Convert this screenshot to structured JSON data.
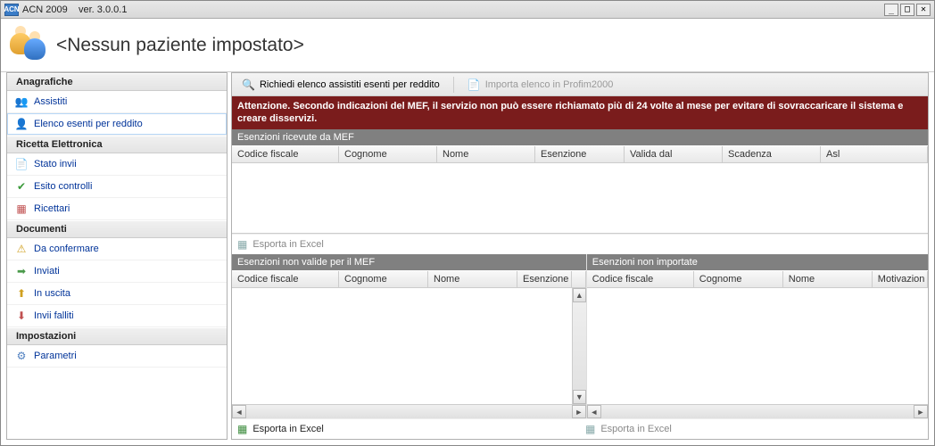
{
  "window": {
    "app_label": "ACN 2009",
    "version_prefix": "ver.",
    "version": "3.0.0.1",
    "app_icon_text": "ACN"
  },
  "header": {
    "title": "<Nessun paziente impostato>"
  },
  "sidebar": {
    "sections": [
      {
        "title": "Anagrafiche",
        "items": [
          {
            "label": "Assistiti",
            "icon": "people-icon",
            "glyph": "👥"
          },
          {
            "label": "Elenco esenti per reddito",
            "icon": "exemption-icon",
            "glyph": "👤",
            "selected": true
          }
        ]
      },
      {
        "title": "Ricetta Elettronica",
        "items": [
          {
            "label": "Stato invii",
            "icon": "status-icon",
            "glyph": "📄"
          },
          {
            "label": "Esito controlli",
            "icon": "check-icon",
            "glyph": "✔"
          },
          {
            "label": "Ricettari",
            "icon": "calendar-icon",
            "glyph": "▦"
          }
        ]
      },
      {
        "title": "Documenti",
        "items": [
          {
            "label": "Da confermare",
            "icon": "warn-icon",
            "glyph": "⚠"
          },
          {
            "label": "Inviati",
            "icon": "sent-icon",
            "glyph": "➡"
          },
          {
            "label": "In uscita",
            "icon": "outbox-icon",
            "glyph": "⬆"
          },
          {
            "label": "Invii falliti",
            "icon": "failed-icon",
            "glyph": "⬇"
          }
        ]
      },
      {
        "title": "Impostazioni",
        "items": [
          {
            "label": "Parametri",
            "icon": "gear-icon",
            "glyph": "⚙"
          }
        ]
      }
    ]
  },
  "toolbar": {
    "request_label": "Richiedi elenco assistiti esenti per reddito",
    "import_label": "Importa elenco in Profim2000"
  },
  "warning": "Attenzione. Secondo indicazioni del MEF, il servizio non può essere richiamato più di 24 volte al mese per evitare di sovraccaricare il sistema e creare disservizi.",
  "panels": {
    "received": {
      "title": "Esenzioni ricevute da MEF",
      "columns": [
        "Codice fiscale",
        "Cognome",
        "Nome",
        "Esenzione",
        "Valida dal",
        "Scadenza",
        "Asl"
      ],
      "export_label": "Esporta in Excel"
    },
    "invalid": {
      "title": "Esenzioni non valide per il MEF",
      "columns": [
        "Codice fiscale",
        "Cognome",
        "Nome",
        "Esenzione"
      ],
      "export_label": "Esporta in Excel"
    },
    "not_imported": {
      "title": "Esenzioni non importate",
      "columns": [
        "Codice fiscale",
        "Cognome",
        "Nome",
        "Motivazion"
      ],
      "export_label": "Esporta in Excel"
    }
  }
}
